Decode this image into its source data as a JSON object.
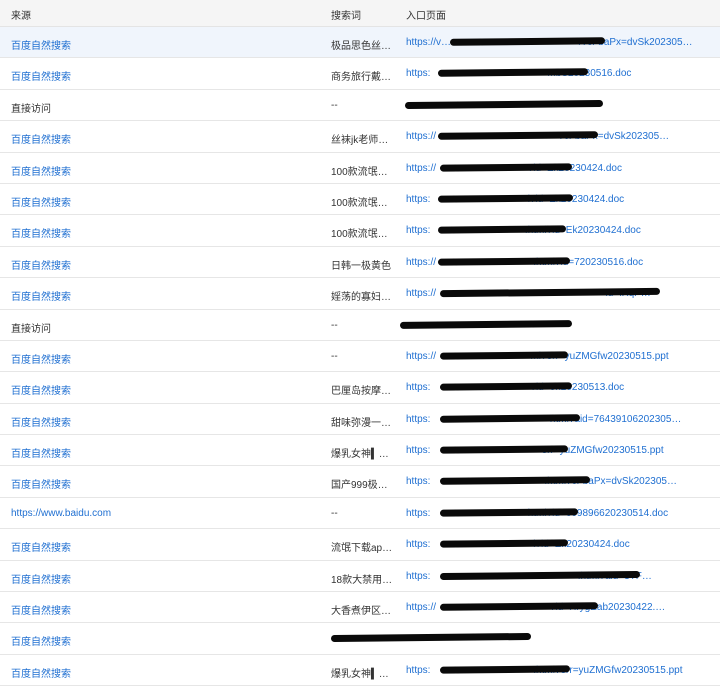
{
  "header": {
    "col_source": "来源",
    "col_keyword": "搜索词",
    "col_entry": "入口页面"
  },
  "colors": {
    "link": "#1f6fd1",
    "header_bg": "#f5f5f5",
    "selected_row_bg": "#f0f5fc",
    "redaction": "#0a0a0a"
  },
  "rows": [
    {
      "source": "百度自然搜索",
      "source_link": true,
      "keyword": "极品思色丝…",
      "entry": "https://v…                                              /?cFbaPx=dvSk202305…"
    },
    {
      "source": "百度自然搜索",
      "source_link": true,
      "keyword": "商务旅行戴…",
      "entry": "https:                                        =MbS20230516.doc"
    },
    {
      "source": "直接访问",
      "source_link": false,
      "keyword": "--",
      "entry": ""
    },
    {
      "source": "百度自然搜索",
      "source_link": true,
      "keyword": "丝袜jk老师…",
      "entry": "https://                                            ?cFbaPx=dvSk202305…"
    },
    {
      "source": "百度自然搜索",
      "source_link": true,
      "keyword": "100款流氓…",
      "entry": "https://                                 ?id=Ek20230424.doc"
    },
    {
      "source": "百度自然搜索",
      "source_link": true,
      "keyword": "100款流氓…",
      "entry": "https:                                   l?id=Ek20230424.doc"
    },
    {
      "source": "百度自然搜索",
      "source_link": true,
      "keyword": "100款流氓…",
      "entry": "https:                                  .html?id=Ek20230424.doc"
    },
    {
      "source": "百度自然搜索",
      "source_link": true,
      "keyword": "日韩一极黄色",
      "entry": "https://                                   .html?id=720230516.doc"
    },
    {
      "source": "百度自然搜索",
      "source_link": true,
      "keyword": "婬荡的寡妇…",
      "entry": "https://                                                             id=fXqP…"
    },
    {
      "source": "直接访问",
      "source_link": false,
      "keyword": "--",
      "entry": ""
    },
    {
      "source": "百度自然搜索",
      "source_link": true,
      "keyword": "--",
      "entry": "https://                                  ml?3rr=yuZMGfw20230515.ppt"
    },
    {
      "source": "百度自然搜索",
      "source_link": true,
      "keyword": "巴厘岛按摩…",
      "entry": "https:                                    ?id=on20230513.doc"
    },
    {
      "source": "百度自然搜索",
      "source_link": true,
      "keyword": "甜味弥漫一…",
      "entry": "https:                                           html?aid=76439106202305…"
    },
    {
      "source": "百度自然搜索",
      "source_link": true,
      "keyword": "爆乳女神▍…",
      "entry": "https:                                        3rr=yuZMGfw20230515.ppt"
    },
    {
      "source": "百度自然搜索",
      "source_link": true,
      "keyword": "国产999极…",
      "entry": "https:                                         .html?cFbaPx=dvSk202305…"
    },
    {
      "source": "https://www.baidu.com",
      "source_link": true,
      "keyword": "--",
      "entry": "https:                                   html?id=609896620230514.doc"
    },
    {
      "source": "百度自然搜索",
      "source_link": true,
      "keyword": "流氓下载ap…",
      "entry": "https:                                     l?id=Ek20230424.doc"
    },
    {
      "source": "百度自然搜索",
      "source_link": true,
      "keyword": "18款大禁用…",
      "entry": "https:                                                     .html?aid=3TF…"
    },
    {
      "source": "百度自然搜索",
      "source_link": true,
      "keyword": "大香煮伊区…",
      "entry": "https://                                         ?id=HrygEab20230422.…"
    },
    {
      "source": "百度自然搜索",
      "source_link": true,
      "keyword": "",
      "entry": ""
    },
    {
      "source": "百度自然搜索",
      "source_link": true,
      "keyword": "爆乳女神▍…",
      "entry": "https:                                     .html?3rr=yuZMGfw20230515.ppt"
    }
  ]
}
